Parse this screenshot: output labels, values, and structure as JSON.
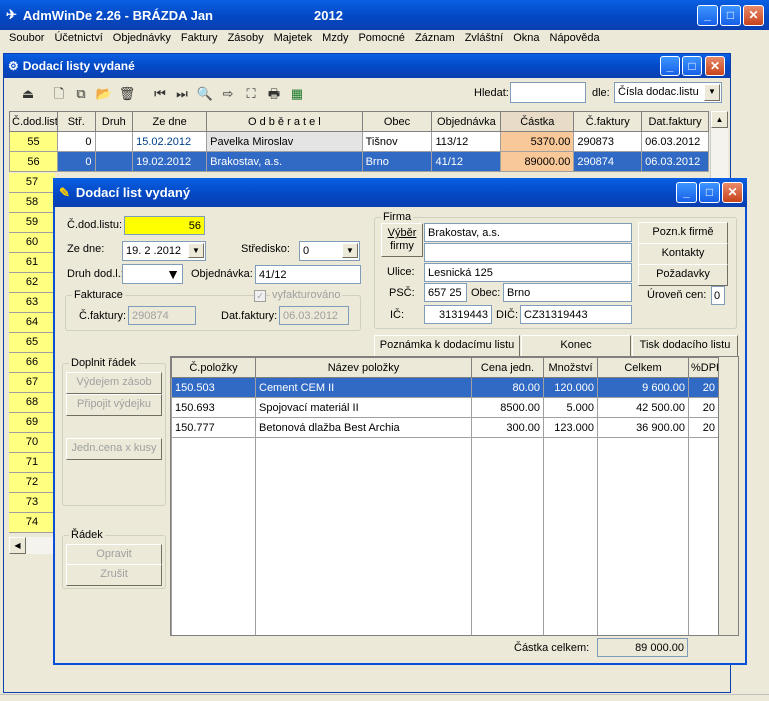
{
  "app": {
    "title": "AdmWinDe 2.26 - BRÁZDA Jan",
    "year": "2012"
  },
  "menu": [
    "Soubor",
    "Účetnictví",
    "Objednávky",
    "Faktury",
    "Zásoby",
    "Majetek",
    "Mzdy",
    "Pomocné",
    "Záznam",
    "Zvláštní",
    "Okna",
    "Nápověda"
  ],
  "list_window": {
    "title": "Dodací listy vydané",
    "search_label": "Hledat:",
    "search_value": "",
    "by_label": "dle:",
    "by_value": "Čísla dodac.listu",
    "columns": [
      "Č.dod.listu",
      "Stř.",
      "Druh",
      "Ze dne",
      "O d b ě r a t e l",
      "Obec",
      "Objednávka",
      "Částka",
      "Č.faktury",
      "Dat.faktury"
    ],
    "rows": [
      [
        "55",
        "0",
        "",
        "15.02.2012",
        "Pavelka Miroslav",
        "Tišnov",
        "113/12",
        "5370.00",
        "290873",
        "06.03.2012"
      ],
      [
        "56",
        "0",
        "",
        "19.02.2012",
        "Brakostav, a.s.",
        "Brno",
        "41/12",
        "89000.00",
        "290874",
        "06.03.2012"
      ]
    ],
    "row_numbers": [
      "57",
      "58",
      "59",
      "60",
      "61",
      "62",
      "63",
      "64",
      "65",
      "66",
      "67",
      "68",
      "69",
      "70",
      "71",
      "72",
      "73",
      "74"
    ]
  },
  "dialog": {
    "title": "Dodací list vydaný",
    "cdl_label": "Č.dod.listu:",
    "cdl_value": "56",
    "date_label": "Ze dne:",
    "date_value": "19. 2 .2012",
    "stredisko_label": "Středisko:",
    "stredisko_value": "0",
    "druh_label": "Druh dod.l.:",
    "druh_value": "",
    "objednavka_label": "Objednávka:",
    "objednavka_value": "41/12",
    "fakturace": {
      "title": "Fakturace",
      "checkbox": "vyfakturováno",
      "cf_label": "Č.faktury:",
      "cf_value": "290874",
      "dat_label": "Dat.faktury:",
      "dat_value": "06.03.2012"
    },
    "firma": {
      "title": "Firma",
      "vyber_btn_1": "Výběr",
      "vyber_btn_2": "firmy",
      "name": "Brakostav, a.s.",
      "name2": "",
      "ulice_label": "Ulice:",
      "ulice": "Lesnická 125",
      "psc_label": "PSČ:",
      "psc": "657 25",
      "obec_label": "Obec:",
      "obec": "Brno",
      "ic_label": "IČ:",
      "ic": "31319443",
      "dic_label": "DIČ:",
      "dic": "CZ31319443",
      "pozn_btn": "Pozn.k firmě",
      "kontakty_btn": "Kontakty",
      "pozadavky_btn": "Požadavky",
      "uroven_label": "Úroveň cen:",
      "uroven_value": "0"
    },
    "poznamka_btn": "Poznámka k dodacímu listu",
    "konec_btn": "Konec",
    "tisk_btn": "Tisk dodacího listu",
    "doplnit": {
      "title": "Doplnit řádek",
      "vydejem": "Výdejem zásob",
      "pripojit": "Připojit výdejku",
      "jedn": "Jedn.cena x kusy"
    },
    "radek": {
      "title": "Řádek",
      "opravit": "Opravit",
      "zrusit": "Zrušit"
    },
    "items_columns": [
      "Č.položky",
      "Název položky",
      "Cena jedn.",
      "Množství",
      "Celkem",
      "%DPH"
    ],
    "items": [
      [
        "150.503",
        "Cement CEM II",
        "80.00",
        "120.000",
        "9 600.00",
        "20"
      ],
      [
        "150.693",
        "Spojovací materiál II",
        "8500.00",
        "5.000",
        "42 500.00",
        "20"
      ],
      [
        "150.777",
        "Betonová dlažba Best Archia",
        "300.00",
        "123.000",
        "36 900.00",
        "20"
      ]
    ],
    "total_label": "Částka celkem:",
    "total_value": "89 000.00"
  }
}
